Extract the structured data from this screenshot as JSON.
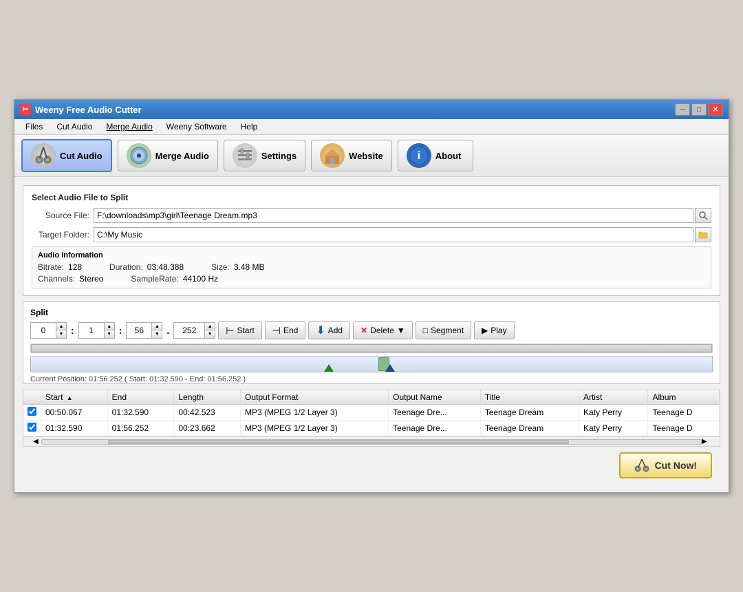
{
  "window": {
    "title": "Weeny Free Audio Cutter",
    "controls": [
      "minimize",
      "maximize",
      "close"
    ]
  },
  "menubar": {
    "items": [
      {
        "label": "Files",
        "underline": false
      },
      {
        "label": "Cut Audio",
        "underline": false
      },
      {
        "label": "Merge Audio",
        "underline": true
      },
      {
        "label": "Weeny Software",
        "underline": false
      },
      {
        "label": "Help",
        "underline": false
      }
    ]
  },
  "toolbar": {
    "buttons": [
      {
        "id": "cut-audio",
        "label": "Cut Audio",
        "icon": "✂",
        "active": true
      },
      {
        "id": "merge-audio",
        "label": "Merge Audio",
        "icon": "💿",
        "active": false
      },
      {
        "id": "settings",
        "label": "Settings",
        "icon": "📋",
        "active": false
      },
      {
        "id": "website",
        "label": "Website",
        "icon": "🏠",
        "active": false
      },
      {
        "id": "about",
        "label": "About",
        "icon": "ℹ",
        "active": false
      }
    ]
  },
  "source_section": {
    "title": "Select Audio File to Split",
    "source_label": "Source File:",
    "source_value": "F:\\downloads\\mp3\\girl\\Teenage Dream.mp3",
    "target_label": "Target Folder:",
    "target_value": "C:\\My Music"
  },
  "audio_info": {
    "title": "Audio Information",
    "bitrate_label": "Bitrate:",
    "bitrate_value": "128",
    "duration_label": "Duration:",
    "duration_value": "03:48.388",
    "size_label": "Size:",
    "size_value": "3.48 MB",
    "channels_label": "Channels:",
    "channels_value": "Stereo",
    "samplerate_label": "SampleRate:",
    "samplerate_value": "44100 Hz"
  },
  "split": {
    "title": "Split",
    "h_val": "0",
    "m_val": "1",
    "s_val": "56",
    "ms_val": "252",
    "start_label": "Start",
    "end_label": "End",
    "add_label": "Add",
    "delete_label": "Delete",
    "segment_label": "Segment",
    "play_label": "Play",
    "position_text": "Current Position: 01:56.252 ( Start: 01:32.590 - End: 01:56.252 )"
  },
  "table": {
    "columns": [
      "",
      "Start",
      "End",
      "Length",
      "Output Format",
      "Output Name",
      "Title",
      "Artist",
      "Album"
    ],
    "rows": [
      {
        "checked": true,
        "start": "00:50.067",
        "end": "01:32.590",
        "length": "00:42.523",
        "format": "MP3 (MPEG 1/2 Layer 3)",
        "output_name": "Teenage Dre...",
        "title": "Teenage Dream",
        "artist": "Katy Perry",
        "album": "Teenage D"
      },
      {
        "checked": true,
        "start": "01:32.590",
        "end": "01:56.252",
        "length": "00:23.662",
        "format": "MP3 (MPEG 1/2 Layer 3)",
        "output_name": "Teenage Dre...",
        "title": "Teenage Dream",
        "artist": "Katy Perry",
        "album": "Teenage D"
      }
    ]
  },
  "footer": {
    "cut_now_label": "Cut Now!"
  }
}
